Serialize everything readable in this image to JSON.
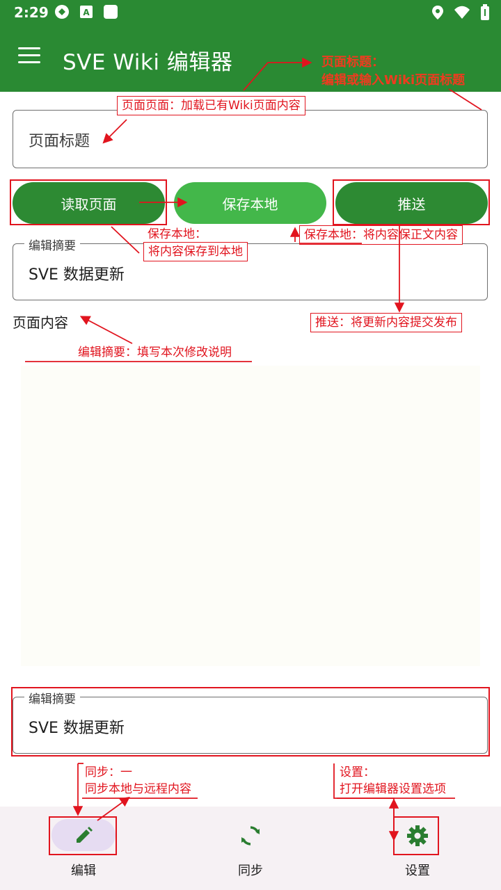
{
  "status": {
    "time": "2:29"
  },
  "app": {
    "title": "SVE Wiki 编辑器"
  },
  "title_field": {
    "placeholder": "页面标题"
  },
  "buttons": {
    "read": "读取页面",
    "save": "保存本地",
    "push": "推送"
  },
  "summary": {
    "legend": "编辑摘要",
    "value": "SVE 数据更新"
  },
  "content": {
    "label": "页面内容"
  },
  "summary_bottom": {
    "legend": "编辑摘要",
    "value": "SVE 数据更新"
  },
  "nav": {
    "edit": "编辑",
    "sync": "同步",
    "settings": "设置"
  },
  "colors": {
    "primary": "#2a8a33",
    "save_button": "#43b74a",
    "annotation": "#e1141e"
  },
  "annotations": {
    "title_note_1": "页面标题：",
    "title_note_2": "编辑或输入Wiki页面标题",
    "load_note": "页面页面：加载已有Wiki页面内容",
    "save_note_1": "保存本地：",
    "save_note_2": "将内容保存到本地",
    "save_note_right": "保存本地：将内容保正文内容",
    "push_note": "推送：将更新内容提交发布",
    "summary_note": "编辑摘要：填写本次修改说明",
    "sync_note_1": "同步：一",
    "sync_note_2": "同步本地与远程内容",
    "settings_note_1": "设置：",
    "settings_note_2": "打开编辑器设置选项"
  }
}
